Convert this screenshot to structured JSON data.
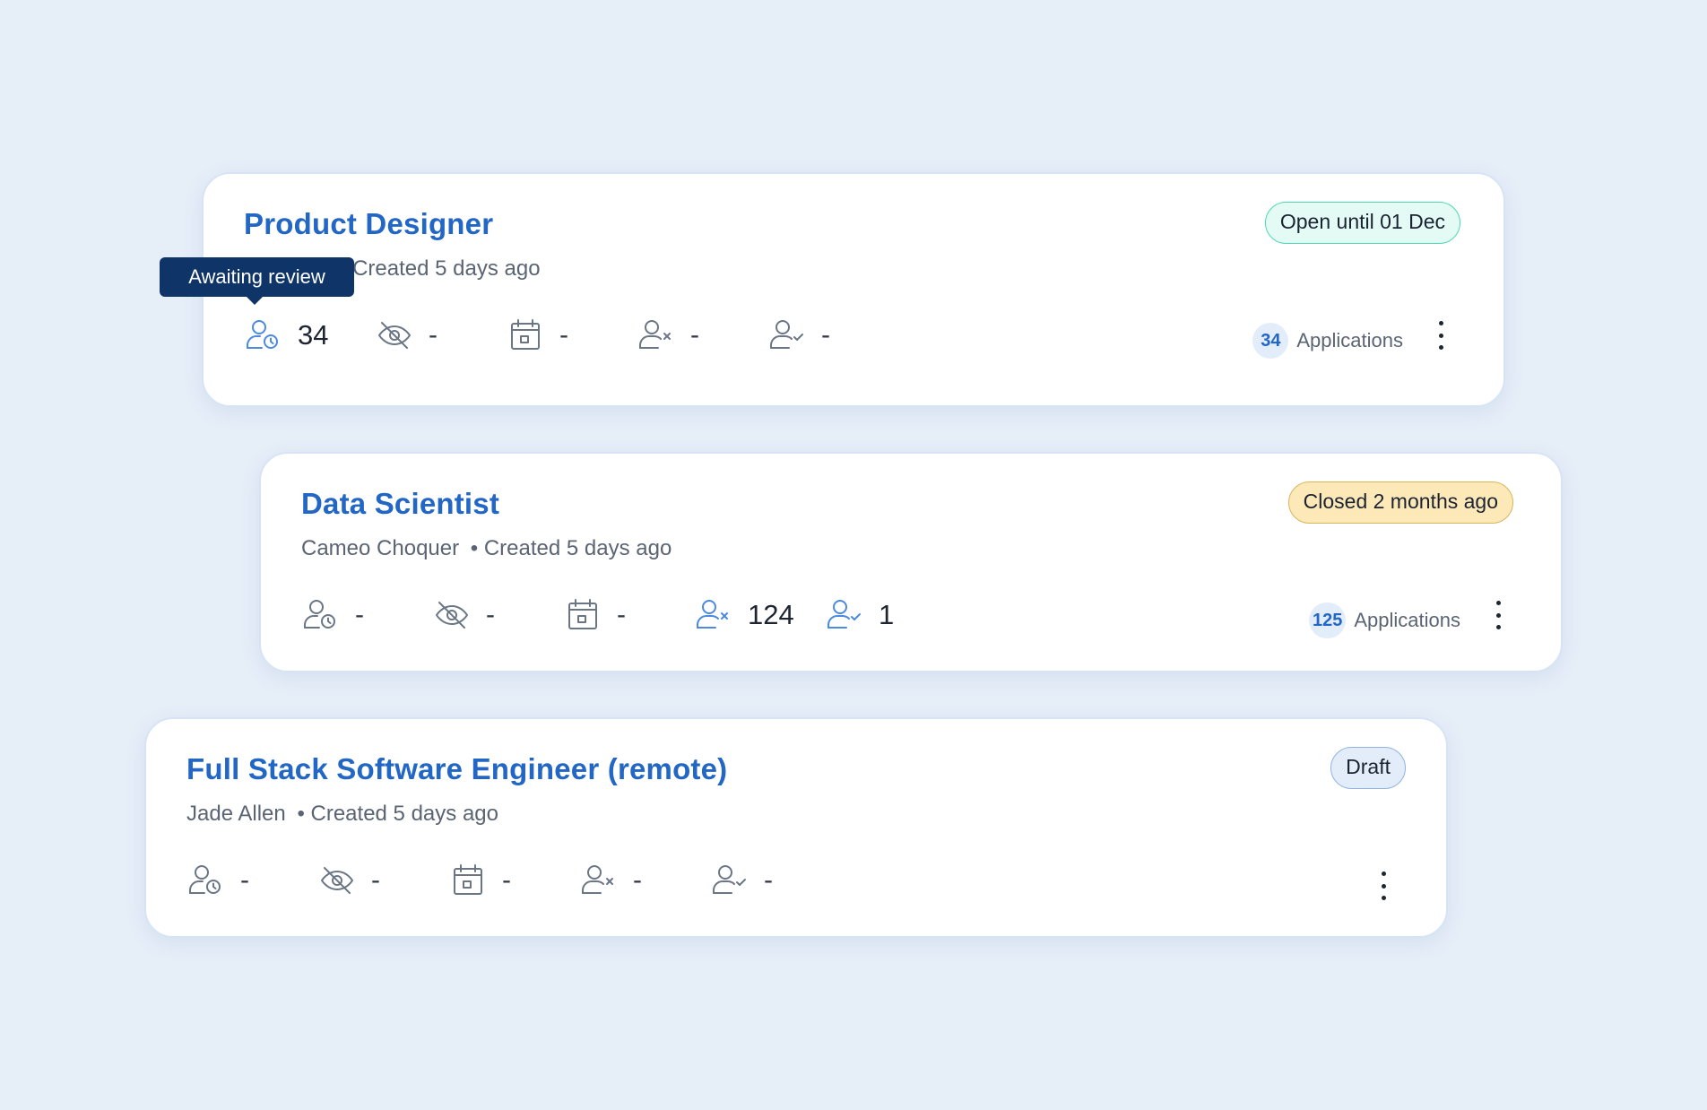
{
  "colors": {
    "accent": "#2266c6",
    "icon_muted": "#6b7685",
    "icon_active": "#4a8ae0",
    "tooltip_bg": "#0f3467",
    "badge_open_bg": "#e3fbf4",
    "badge_closed_bg": "#fde9b8",
    "badge_draft_bg": "#e3edf9"
  },
  "tooltip": {
    "text": "Awaiting review"
  },
  "jobs": [
    {
      "title": "Product Designer",
      "owner": "",
      "created": "• Created 5 days ago",
      "status": "Open until 01 Dec",
      "status_kind": "open",
      "stats": [
        {
          "icon": "user-clock-icon",
          "value": "34",
          "active": true
        },
        {
          "icon": "eye-off-icon",
          "value": "-",
          "active": false
        },
        {
          "icon": "calendar-icon",
          "value": "-",
          "active": false
        },
        {
          "icon": "user-x-icon",
          "value": "-",
          "active": false
        },
        {
          "icon": "user-check-icon",
          "value": "-",
          "active": false
        }
      ],
      "applications_count": "34",
      "applications_label": "Applications"
    },
    {
      "title": "Data Scientist",
      "owner": "Cameo Choquer",
      "created": "• Created 5 days ago",
      "status": "Closed 2 months ago",
      "status_kind": "closed",
      "stats": [
        {
          "icon": "user-clock-icon",
          "value": "-",
          "active": false
        },
        {
          "icon": "eye-off-icon",
          "value": "-",
          "active": false
        },
        {
          "icon": "calendar-icon",
          "value": "-",
          "active": false
        },
        {
          "icon": "user-x-icon",
          "value": "124",
          "active": true
        },
        {
          "icon": "user-check-icon",
          "value": "1",
          "active": true
        }
      ],
      "applications_count": "125",
      "applications_label": "Applications"
    },
    {
      "title": "Full Stack Software Engineer (remote)",
      "owner": "Jade Allen",
      "created": "• Created 5 days ago",
      "status": "Draft",
      "status_kind": "draft",
      "stats": [
        {
          "icon": "user-clock-icon",
          "value": "-",
          "active": false
        },
        {
          "icon": "eye-off-icon",
          "value": "-",
          "active": false
        },
        {
          "icon": "calendar-icon",
          "value": "-",
          "active": false
        },
        {
          "icon": "user-x-icon",
          "value": "-",
          "active": false
        },
        {
          "icon": "user-check-icon",
          "value": "-",
          "active": false
        }
      ]
    }
  ]
}
